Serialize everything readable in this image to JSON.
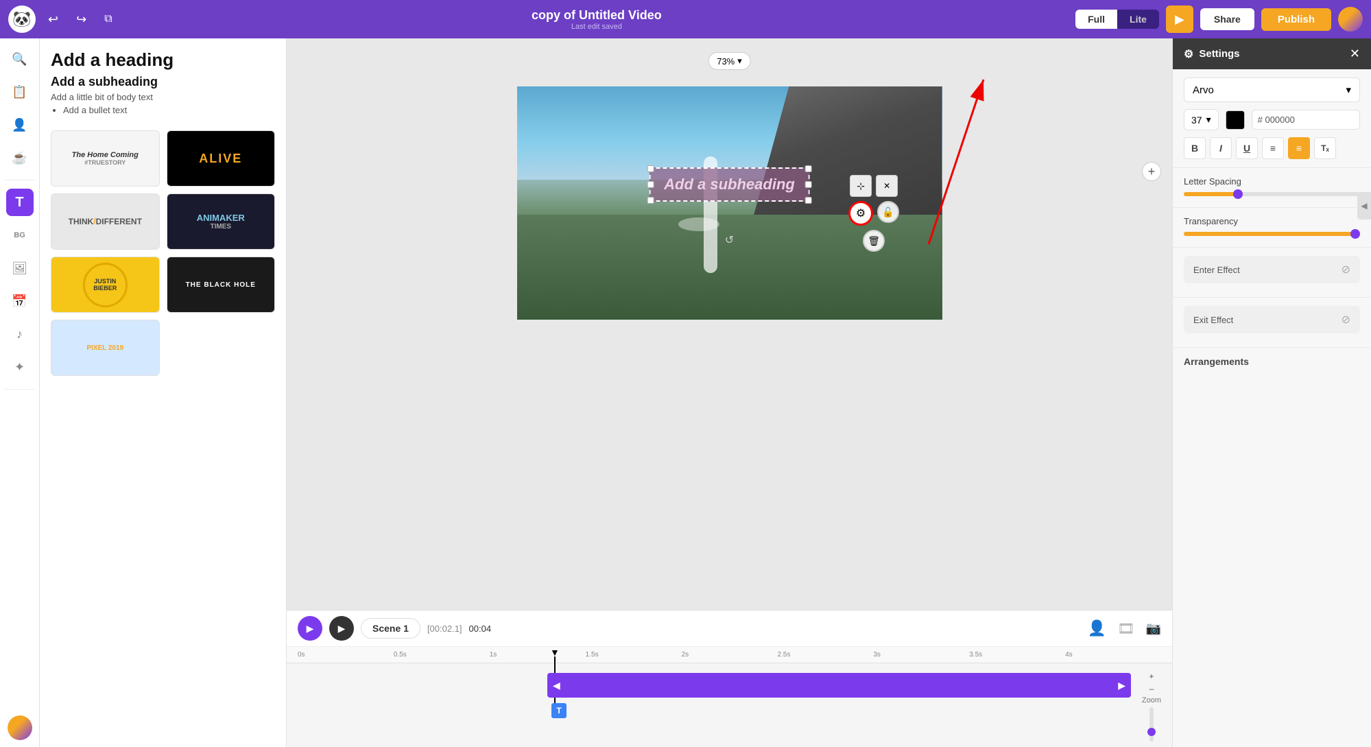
{
  "topbar": {
    "logo": "🐼",
    "title": "copy of Untitled Video",
    "saved_text": "Last edit saved",
    "undo_icon": "↩",
    "redo_icon": "↪",
    "copy_icon": "⧉",
    "full_label": "Full",
    "lite_label": "Lite",
    "play_icon": "▶",
    "share_label": "Share",
    "publish_label": "Publish"
  },
  "left_sidebar": {
    "icons": [
      {
        "name": "search",
        "symbol": "🔍",
        "active": false
      },
      {
        "name": "templates",
        "symbol": "📋",
        "active": false
      },
      {
        "name": "user",
        "symbol": "👤",
        "active": false
      },
      {
        "name": "coffee",
        "symbol": "☕",
        "active": false
      },
      {
        "name": "text",
        "symbol": "T",
        "active": true
      },
      {
        "name": "background",
        "symbol": "BG",
        "active": false
      },
      {
        "name": "image",
        "symbol": "🖼",
        "active": false
      },
      {
        "name": "calendar",
        "symbol": "📅",
        "active": false
      },
      {
        "name": "music",
        "symbol": "♪",
        "active": false
      },
      {
        "name": "effects",
        "symbol": "✨",
        "active": false
      }
    ]
  },
  "templates_panel": {
    "heading": "Add a heading",
    "subheading": "Add a subheading",
    "body_text": "Add a little bit of body text",
    "bullet": "Add a bullet text",
    "templates": [
      {
        "label": "The Home Coming\n#TRUESTORY",
        "style": "t1"
      },
      {
        "label": "ALIVE",
        "style": "t2"
      },
      {
        "label": "THINK/DIFFERENT",
        "style": "t3"
      },
      {
        "label": "ANIMAKER\nTIMES",
        "style": "t4"
      },
      {
        "label": "JUSTIN\nBIEBER",
        "style": "t7"
      },
      {
        "label": "THE BLACK HOLE",
        "style": "t6"
      }
    ]
  },
  "canvas": {
    "zoom_level": "73%",
    "canvas_text": "Add a subheading",
    "add_icon": "+"
  },
  "timeline": {
    "scene_name": "Scene 1",
    "time_display": "[00:02.1]",
    "duration": "00:04",
    "ruler_marks": [
      "0s",
      "0.5s",
      "1s",
      "1.5s",
      "2s",
      "2.5s",
      "3s",
      "3.5s",
      "4s"
    ],
    "play_icon": "▶",
    "track_text": "T"
  },
  "right_panel": {
    "title": "Settings",
    "settings_icon": "⚙",
    "close_icon": "✕",
    "font_name": "Arvo",
    "font_size": "37",
    "color_hex": "000000",
    "format_buttons": [
      {
        "label": "B",
        "name": "bold"
      },
      {
        "label": "I",
        "name": "italic"
      },
      {
        "label": "U",
        "name": "underline"
      },
      {
        "label": "≡",
        "name": "list"
      },
      {
        "label": "≡",
        "name": "align",
        "active": true
      },
      {
        "label": "Tₓ",
        "name": "clear"
      }
    ],
    "letter_spacing_label": "Letter Spacing",
    "transparency_label": "Transparency",
    "enter_effect_label": "Enter Effect",
    "exit_effect_label": "Exit Effect",
    "arrangements_label": "Arrangements",
    "zoom_minus": "–",
    "zoom_label": "Zoom",
    "zoom_plus": "+"
  }
}
